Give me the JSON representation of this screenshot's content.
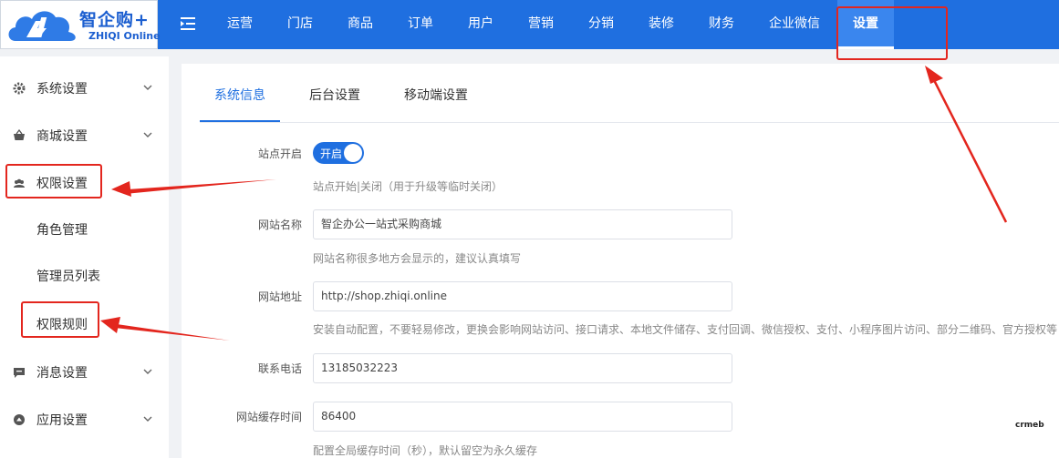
{
  "logo": {
    "cn": "智企购",
    "plus": "+",
    "en": "ZHIQI Online"
  },
  "nav": {
    "items": [
      "运营",
      "门店",
      "商品",
      "订单",
      "用户",
      "营销",
      "分销",
      "装修",
      "财务",
      "企业微信",
      "设置"
    ],
    "active": "设置"
  },
  "sidebar": {
    "items": [
      {
        "label": "系统设置",
        "icon": "gear-icon",
        "expandable": true
      },
      {
        "label": "商城设置",
        "icon": "basket-icon",
        "expandable": true
      },
      {
        "label": "权限设置",
        "icon": "users-icon",
        "expandable": false
      },
      {
        "label": "角色管理",
        "sub": true
      },
      {
        "label": "管理员列表",
        "sub": true
      },
      {
        "label": "权限规则",
        "sub": true
      },
      {
        "label": "消息设置",
        "icon": "message-icon",
        "expandable": true
      },
      {
        "label": "应用设置",
        "icon": "app-icon",
        "expandable": true
      }
    ]
  },
  "tabs": [
    "系统信息",
    "后台设置",
    "移动端设置"
  ],
  "active_tab": "系统信息",
  "form": {
    "site_open": {
      "label": "站点开启",
      "switch_text": "开启",
      "help": "站点开始|关闭（用于升级等临时关闭）"
    },
    "site_name": {
      "label": "网站名称",
      "value": "智企办公一站式采购商城",
      "help": "网站名称很多地方会显示的，建议认真填写"
    },
    "site_url": {
      "label": "网站地址",
      "value": "http://shop.zhiqi.online",
      "help": "安装自动配置，不要轻易修改，更换会影响网站访问、接口请求、本地文件储存、支付回调、微信授权、支付、小程序图片访问、部分二维码、官方授权等"
    },
    "phone": {
      "label": "联系电话",
      "value": "13185032223"
    },
    "cache_time": {
      "label": "网站缓存时间",
      "value": "86400",
      "help": "配置全局缓存时间（秒），默认留空为永久缓存"
    }
  },
  "watermark": "crmeb",
  "colors": {
    "header": "#1f6fe0",
    "active_nav": "#3a86ee",
    "annotation_red": "#e3261e",
    "accent": "#1f6fe0"
  }
}
